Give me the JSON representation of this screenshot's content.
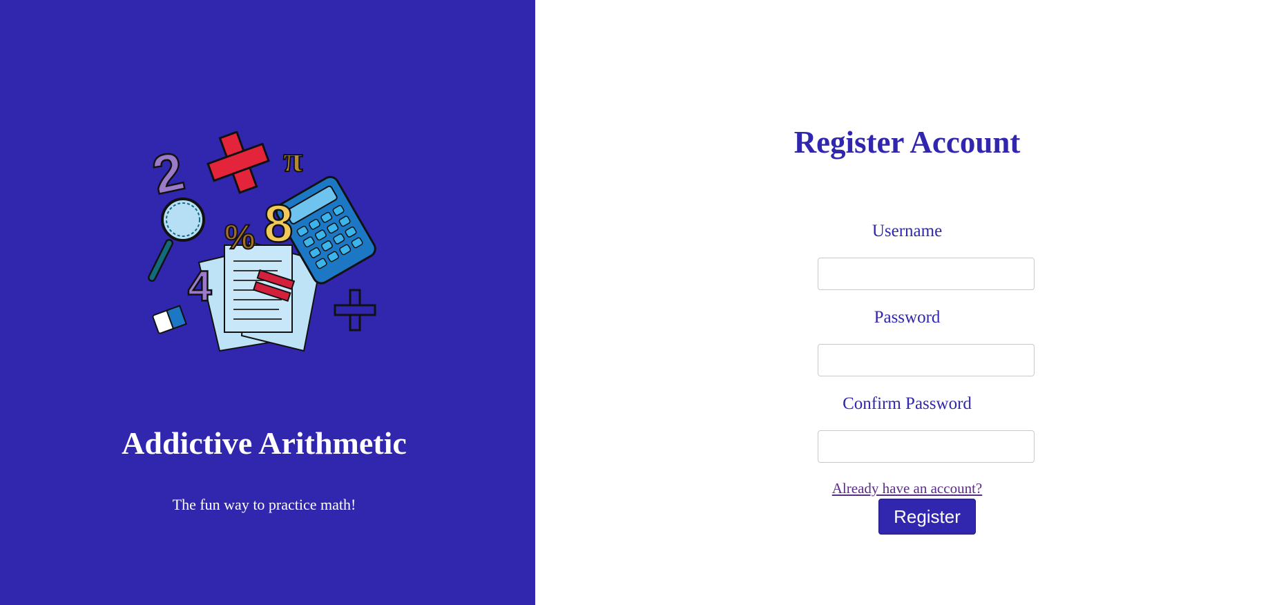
{
  "brand": {
    "title": "Addictive Arithmetic",
    "tagline": "The fun way to practice math!",
    "illustration_icon": "math-illustration-icon",
    "colors": {
      "panel": "#3126ae",
      "text": "#ffffff"
    }
  },
  "form": {
    "title": "Register Account",
    "username_label": "Username",
    "username_value": "",
    "password_label": "Password",
    "password_value": "",
    "confirm_password_label": "Confirm Password",
    "confirm_password_value": "",
    "login_link": "Already have an account?",
    "submit_label": "Register",
    "colors": {
      "accent": "#3126ae",
      "link": "#5a2a86",
      "input_border": "#c9c9c9"
    }
  }
}
